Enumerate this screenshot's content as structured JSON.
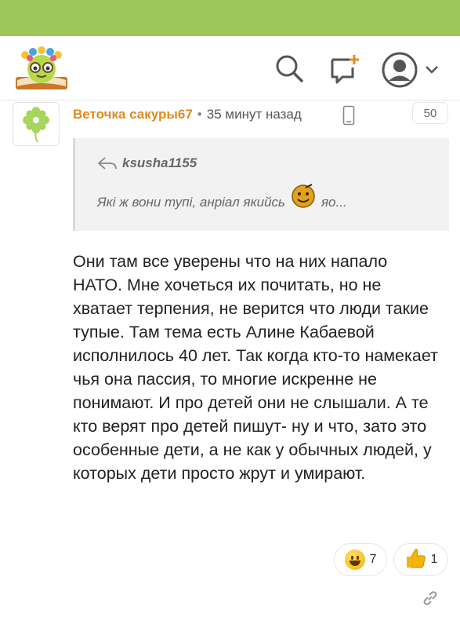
{
  "header": {
    "logo_icon": "flower-crowned-book-mascot",
    "search_icon": "search-icon",
    "compose_icon": "compose-plus-icon",
    "profile_icon": "user-avatar-icon",
    "accent": "#9bc75a"
  },
  "comment": {
    "author": "Веточка сакуры67",
    "separator": "•",
    "time": "35 минут назад",
    "device_icon": "mobile-icon",
    "counter": "50",
    "quote": {
      "author": "ksusha1155",
      "text_before": "Які ж вони тупі, анріал якийсь",
      "text_after": "яо..."
    },
    "body": "Они там все уверены что на них напало НАТО. Мне хочеться их почитать, но не хватает терпения, не верится что люди такие тупые. Там тема есть Алине Кабаевой исполнилось 40 лет. Так когда кто-то намекает чья она пассия, то многие искренне не понимают. И про детей они не слышали. А те кто верят про детей пишут- ну и что, зато это особенные дети, а не как у обычных людей, у которых дети просто жрут и умирают.",
    "reactions": [
      {
        "emoji": "grinning-face",
        "count": "7"
      },
      {
        "emoji": "thumbs-up",
        "count": "1"
      }
    ],
    "author_color": "#e08a1e"
  }
}
